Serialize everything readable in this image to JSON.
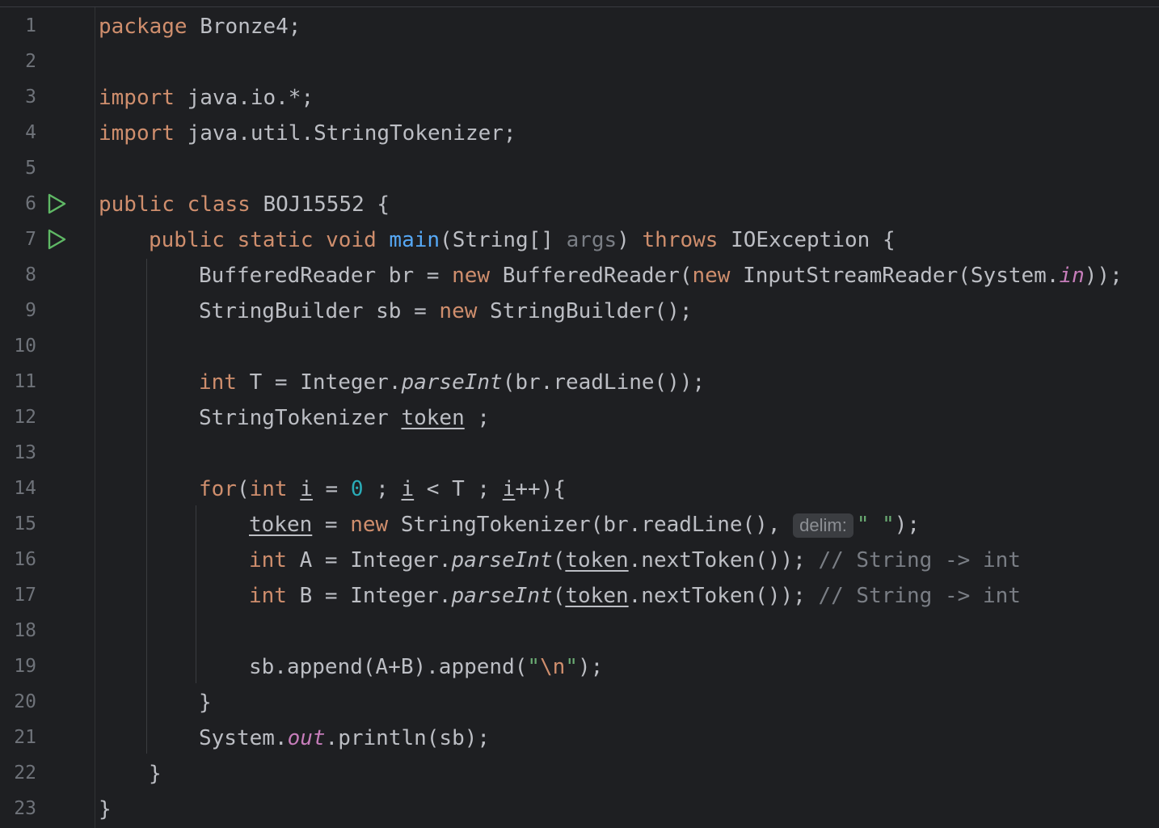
{
  "editor": {
    "line_numbers": [
      "1",
      "2",
      "3",
      "4",
      "5",
      "6",
      "7",
      "8",
      "9",
      "10",
      "11",
      "12",
      "13",
      "14",
      "15",
      "16",
      "17",
      "18",
      "19",
      "20",
      "21",
      "22",
      "23"
    ],
    "run_gutter_lines": [
      "6",
      "7"
    ],
    "tokens": {
      "l1_kw": "package",
      "l1_rest": " Bronze4;",
      "l3_kw": "import",
      "l3_rest": " java.io.*;",
      "l4_kw": "import",
      "l4_rest": " java.util.StringTokenizer;",
      "l6_kw": "public class",
      "l6_rest": " BOJ15552 {",
      "l7_kw1": "public static void",
      "l7_fn": "main",
      "l7_a": "(String[] ",
      "l7_param": "args",
      "l7_b": ") ",
      "l7_kw2": "throws",
      "l7_c": " IOException {",
      "l8_a": "BufferedReader br = ",
      "l8_kw1": "new",
      "l8_b": " BufferedReader(",
      "l8_kw2": "new",
      "l8_c": " InputStreamReader(System.",
      "l8_static": "in",
      "l8_d": "));",
      "l9_a": "StringBuilder sb = ",
      "l9_kw": "new",
      "l9_b": " StringBuilder();",
      "l11_kw": "int",
      "l11_a": " T = Integer.",
      "l11_m": "parseInt",
      "l11_b": "(br.readLine());",
      "l12_a": "StringTokenizer ",
      "l12_var": "token",
      "l12_b": " ;",
      "l14_kw1": "for",
      "l14_a": "(",
      "l14_kw2": "int",
      "l14_sp": " ",
      "l14_i1": "i",
      "l14_b": " = ",
      "l14_num": "0",
      "l14_c": " ; ",
      "l14_i2": "i",
      "l14_d": " < T ; ",
      "l14_i3": "i",
      "l14_e": "++){",
      "l15_var": "token",
      "l15_a": " = ",
      "l15_kw": "new",
      "l15_b": " StringTokenizer(br.readLine(), ",
      "l15_hint": "delim:",
      "l15_str": "\" \"",
      "l15_c": ");",
      "l16_kw": "int",
      "l16_a": " A = Integer.",
      "l16_m": "parseInt",
      "l16_b": "(",
      "l16_var": "token",
      "l16_c": ".nextToken()); ",
      "l16_cmt": "// String -> int",
      "l17_kw": "int",
      "l17_a": " B = Integer.",
      "l17_m": "parseInt",
      "l17_b": "(",
      "l17_var": "token",
      "l17_c": ".nextToken()); ",
      "l17_cmt": "// String -> int",
      "l19_a": "sb.append(A+B).append(",
      "l19_q1": "\"",
      "l19_esc": "\\n",
      "l19_q2": "\"",
      "l19_b": ");",
      "l20": "}",
      "l21_a": "System.",
      "l21_static": "out",
      "l21_b": ".println(sb);",
      "l22": "}",
      "l23": "}"
    }
  },
  "colors": {
    "background": "#1e1f22",
    "keyword": "#cf8e6d",
    "function": "#56a8f5",
    "number": "#2aacb8",
    "string": "#6aab73",
    "comment": "#7a7e85",
    "static_field": "#c77dbb",
    "run_icon": "#5fb865"
  }
}
